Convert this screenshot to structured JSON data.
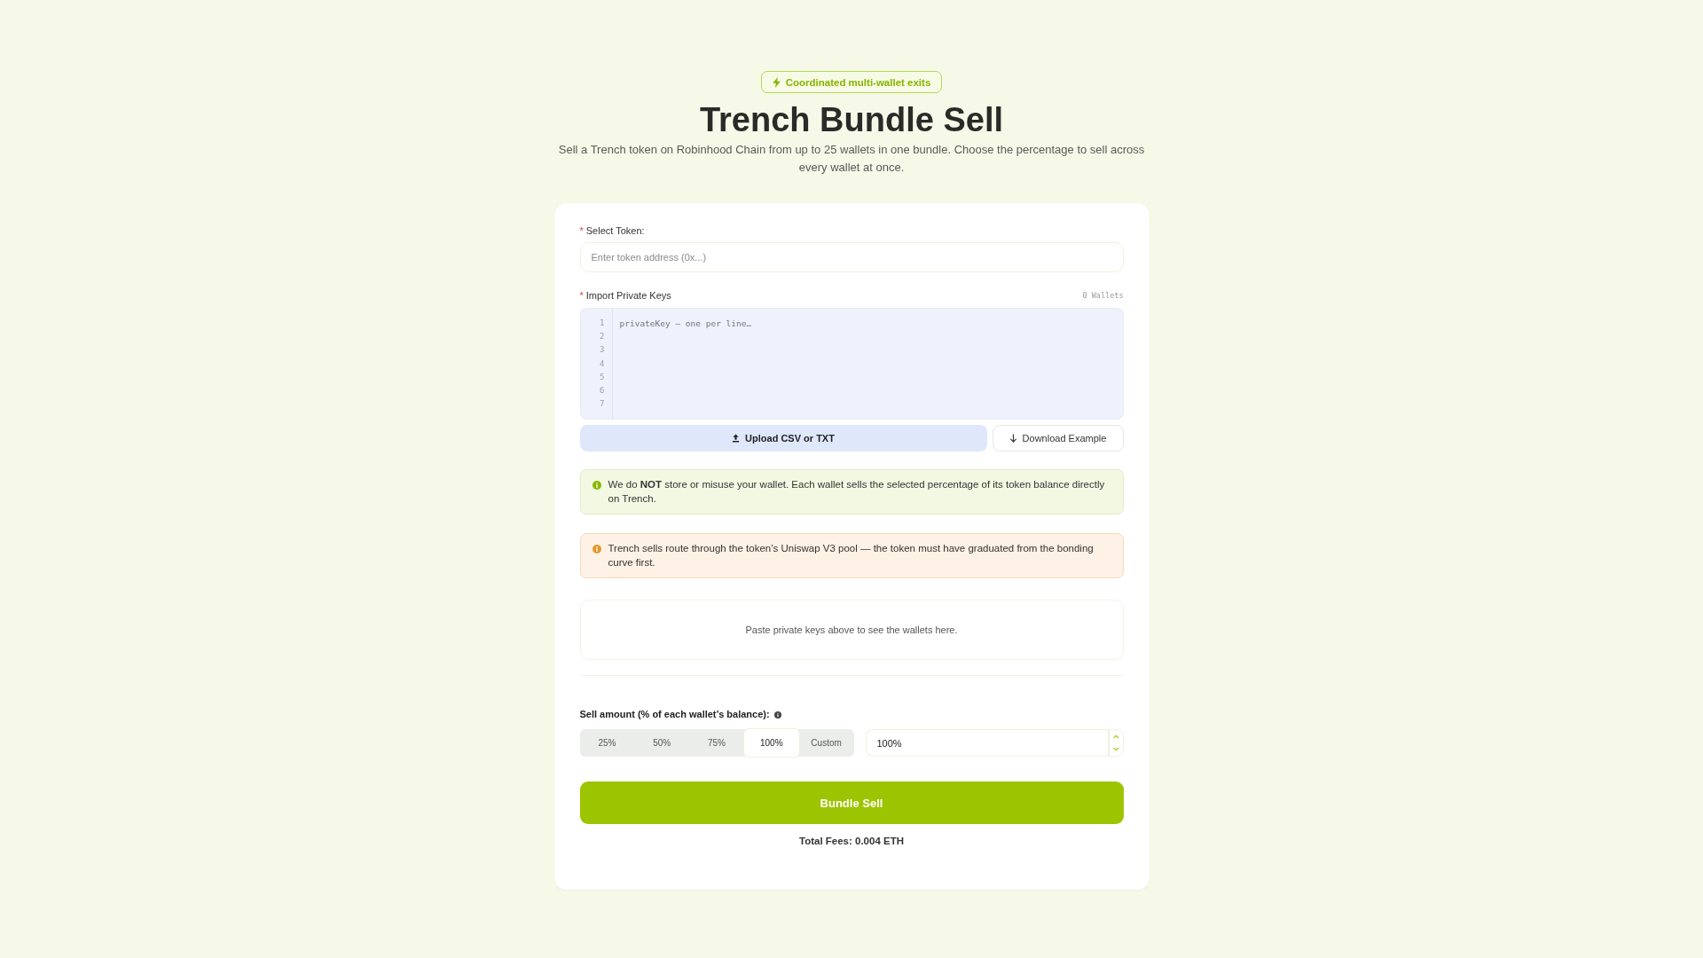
{
  "header": {
    "badge": "Coordinated multi-wallet exits",
    "title": "Trench Bundle Sell",
    "subtitle": "Sell a Trench token on Robinhood Chain from up to 25 wallets in one bundle. Choose the percentage to sell across every wallet at once."
  },
  "form": {
    "token_field": {
      "required_mark": "*",
      "label": "Select Token:",
      "placeholder": "Enter token address (0x...)"
    },
    "keys_field": {
      "required_mark": "*",
      "label": "Import Private Keys",
      "count": "0 Wallets",
      "line_numbers": [
        "1",
        "2",
        "3",
        "4",
        "5",
        "6",
        "7"
      ],
      "placeholder": "privateKey — one per line…"
    },
    "upload_button": "Upload CSV or TXT",
    "download_button": "Download Example",
    "notices": [
      {
        "kind": "info",
        "text": "We do **NOT** store or misuse your wallet. Each wallet sells the selected percentage of its token balance directly on Trench."
      },
      {
        "kind": "warning",
        "text": "Trench sells route through the token’s Uniswap V3 pool — the token must have graduated from the bonding curve first."
      }
    ],
    "wallets_placeholder": "Paste private keys above to see the wallets here.",
    "sell_amount": {
      "label": "Sell amount (% of each wallet’s balance):",
      "options": [
        {
          "label": "25%",
          "selected": false
        },
        {
          "label": "50%",
          "selected": false
        },
        {
          "label": "75%",
          "selected": false
        },
        {
          "label": "100%",
          "selected": true
        },
        {
          "label": "Custom",
          "selected": false
        }
      ],
      "value": "100%"
    },
    "submit_button": "Bundle Sell",
    "total_fees": "Total Fees: 0.004 ETH"
  }
}
